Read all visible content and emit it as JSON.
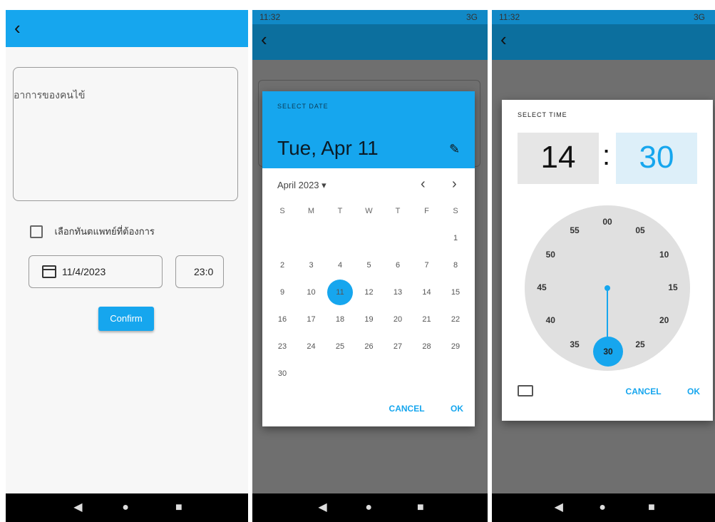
{
  "screen1": {
    "back_icon": "arrow-left-icon",
    "symptom_label": "อาการของคนไข้",
    "checkbox_label": "เลือกทันตแพทย์ที่ต้องการ",
    "date_value": "11/4/2023",
    "time_value": "23:0",
    "confirm_label": "Confirm"
  },
  "statusbar": {
    "time": "11:32",
    "signal": "3G"
  },
  "date_dialog": {
    "header_label": "SELECT DATE",
    "selected_date": "Tue, Apr 11",
    "month_label": "April 2023 ▾",
    "weekdays": [
      "S",
      "M",
      "T",
      "W",
      "T",
      "F",
      "S"
    ],
    "days": [
      "1",
      "2",
      "3",
      "4",
      "5",
      "6",
      "7",
      "8",
      "9",
      "10",
      "11",
      "12",
      "13",
      "14",
      "15",
      "16",
      "17",
      "18",
      "19",
      "20",
      "21",
      "22",
      "23",
      "24",
      "25",
      "26",
      "27",
      "28",
      "29",
      "30"
    ],
    "selected_day": "11",
    "cancel": "CANCEL",
    "ok": "OK"
  },
  "time_dialog": {
    "header_label": "SELECT TIME",
    "hour": "14",
    "minute": "30",
    "minutes": [
      "00",
      "05",
      "10",
      "15",
      "20",
      "25",
      "30",
      "35",
      "40",
      "45",
      "50",
      "55"
    ],
    "cancel": "CANCEL",
    "ok": "OK"
  },
  "colors": {
    "accent": "#16a6ee"
  }
}
